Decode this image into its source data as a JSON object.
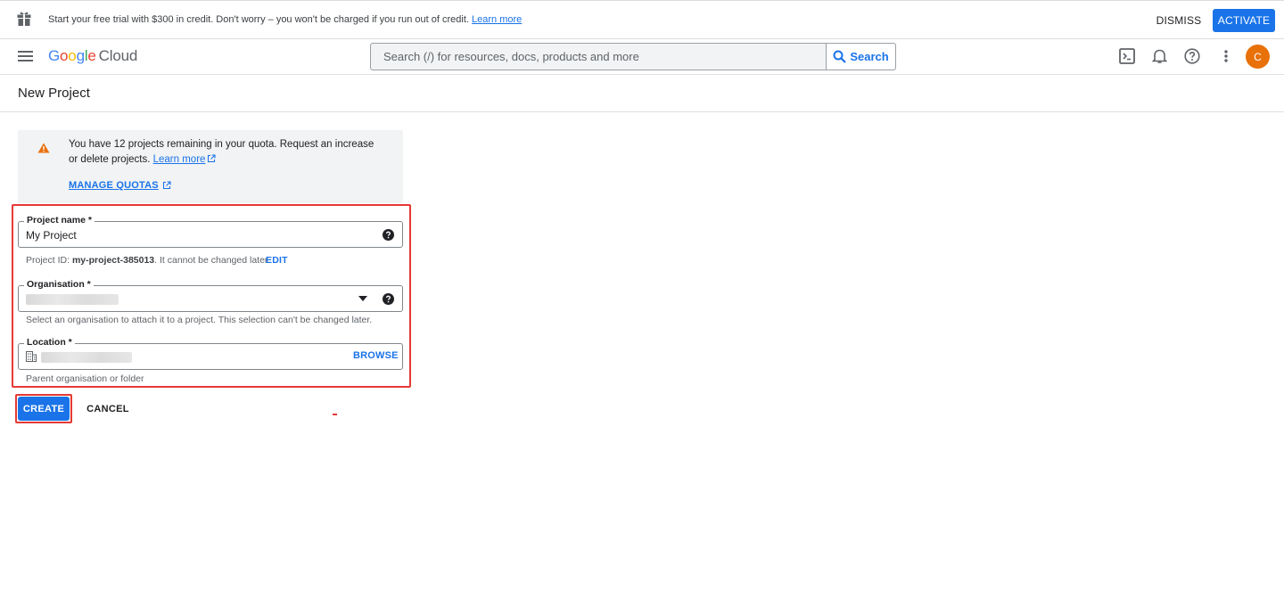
{
  "banner": {
    "icon": "gift-icon",
    "message": "Start your free trial with $300 in credit. Don't worry – you won't be charged if you run out of credit.",
    "learn_more": "Learn more",
    "dismiss": "DISMISS",
    "activate": "ACTIVATE"
  },
  "header": {
    "logo_google": [
      "G",
      "o",
      "o",
      "g",
      "l",
      "e"
    ],
    "logo_cloud": "Cloud",
    "search_placeholder": "Search (/) for resources, docs, products and more",
    "search_button": "Search",
    "avatar_initial": "C"
  },
  "page": {
    "title": "New Project"
  },
  "notice": {
    "text": "You have 12 projects remaining in your quota. Request an increase or delete projects.",
    "learn_more": "Learn more",
    "manage_quotas": "MANAGE QUOTAS"
  },
  "form": {
    "project_name": {
      "label": "Project name *",
      "value": "My Project",
      "hint_prefix": "Project ID: ",
      "project_id": "my-project-385013",
      "hint_suffix": ". It cannot be changed later.",
      "edit": "EDIT"
    },
    "organisation": {
      "label": "Organisation *",
      "hint": "Select an organisation to attach it to a project. This selection can't be changed later."
    },
    "location": {
      "label": "Location *",
      "browse": "BROWSE",
      "hint": "Parent organisation or folder"
    }
  },
  "actions": {
    "create": "CREATE",
    "cancel": "CANCEL"
  },
  "colors": {
    "primary": "#1a73e8",
    "highlight": "#e53935",
    "warning": "#e8710a",
    "avatar": "#e8710a"
  }
}
